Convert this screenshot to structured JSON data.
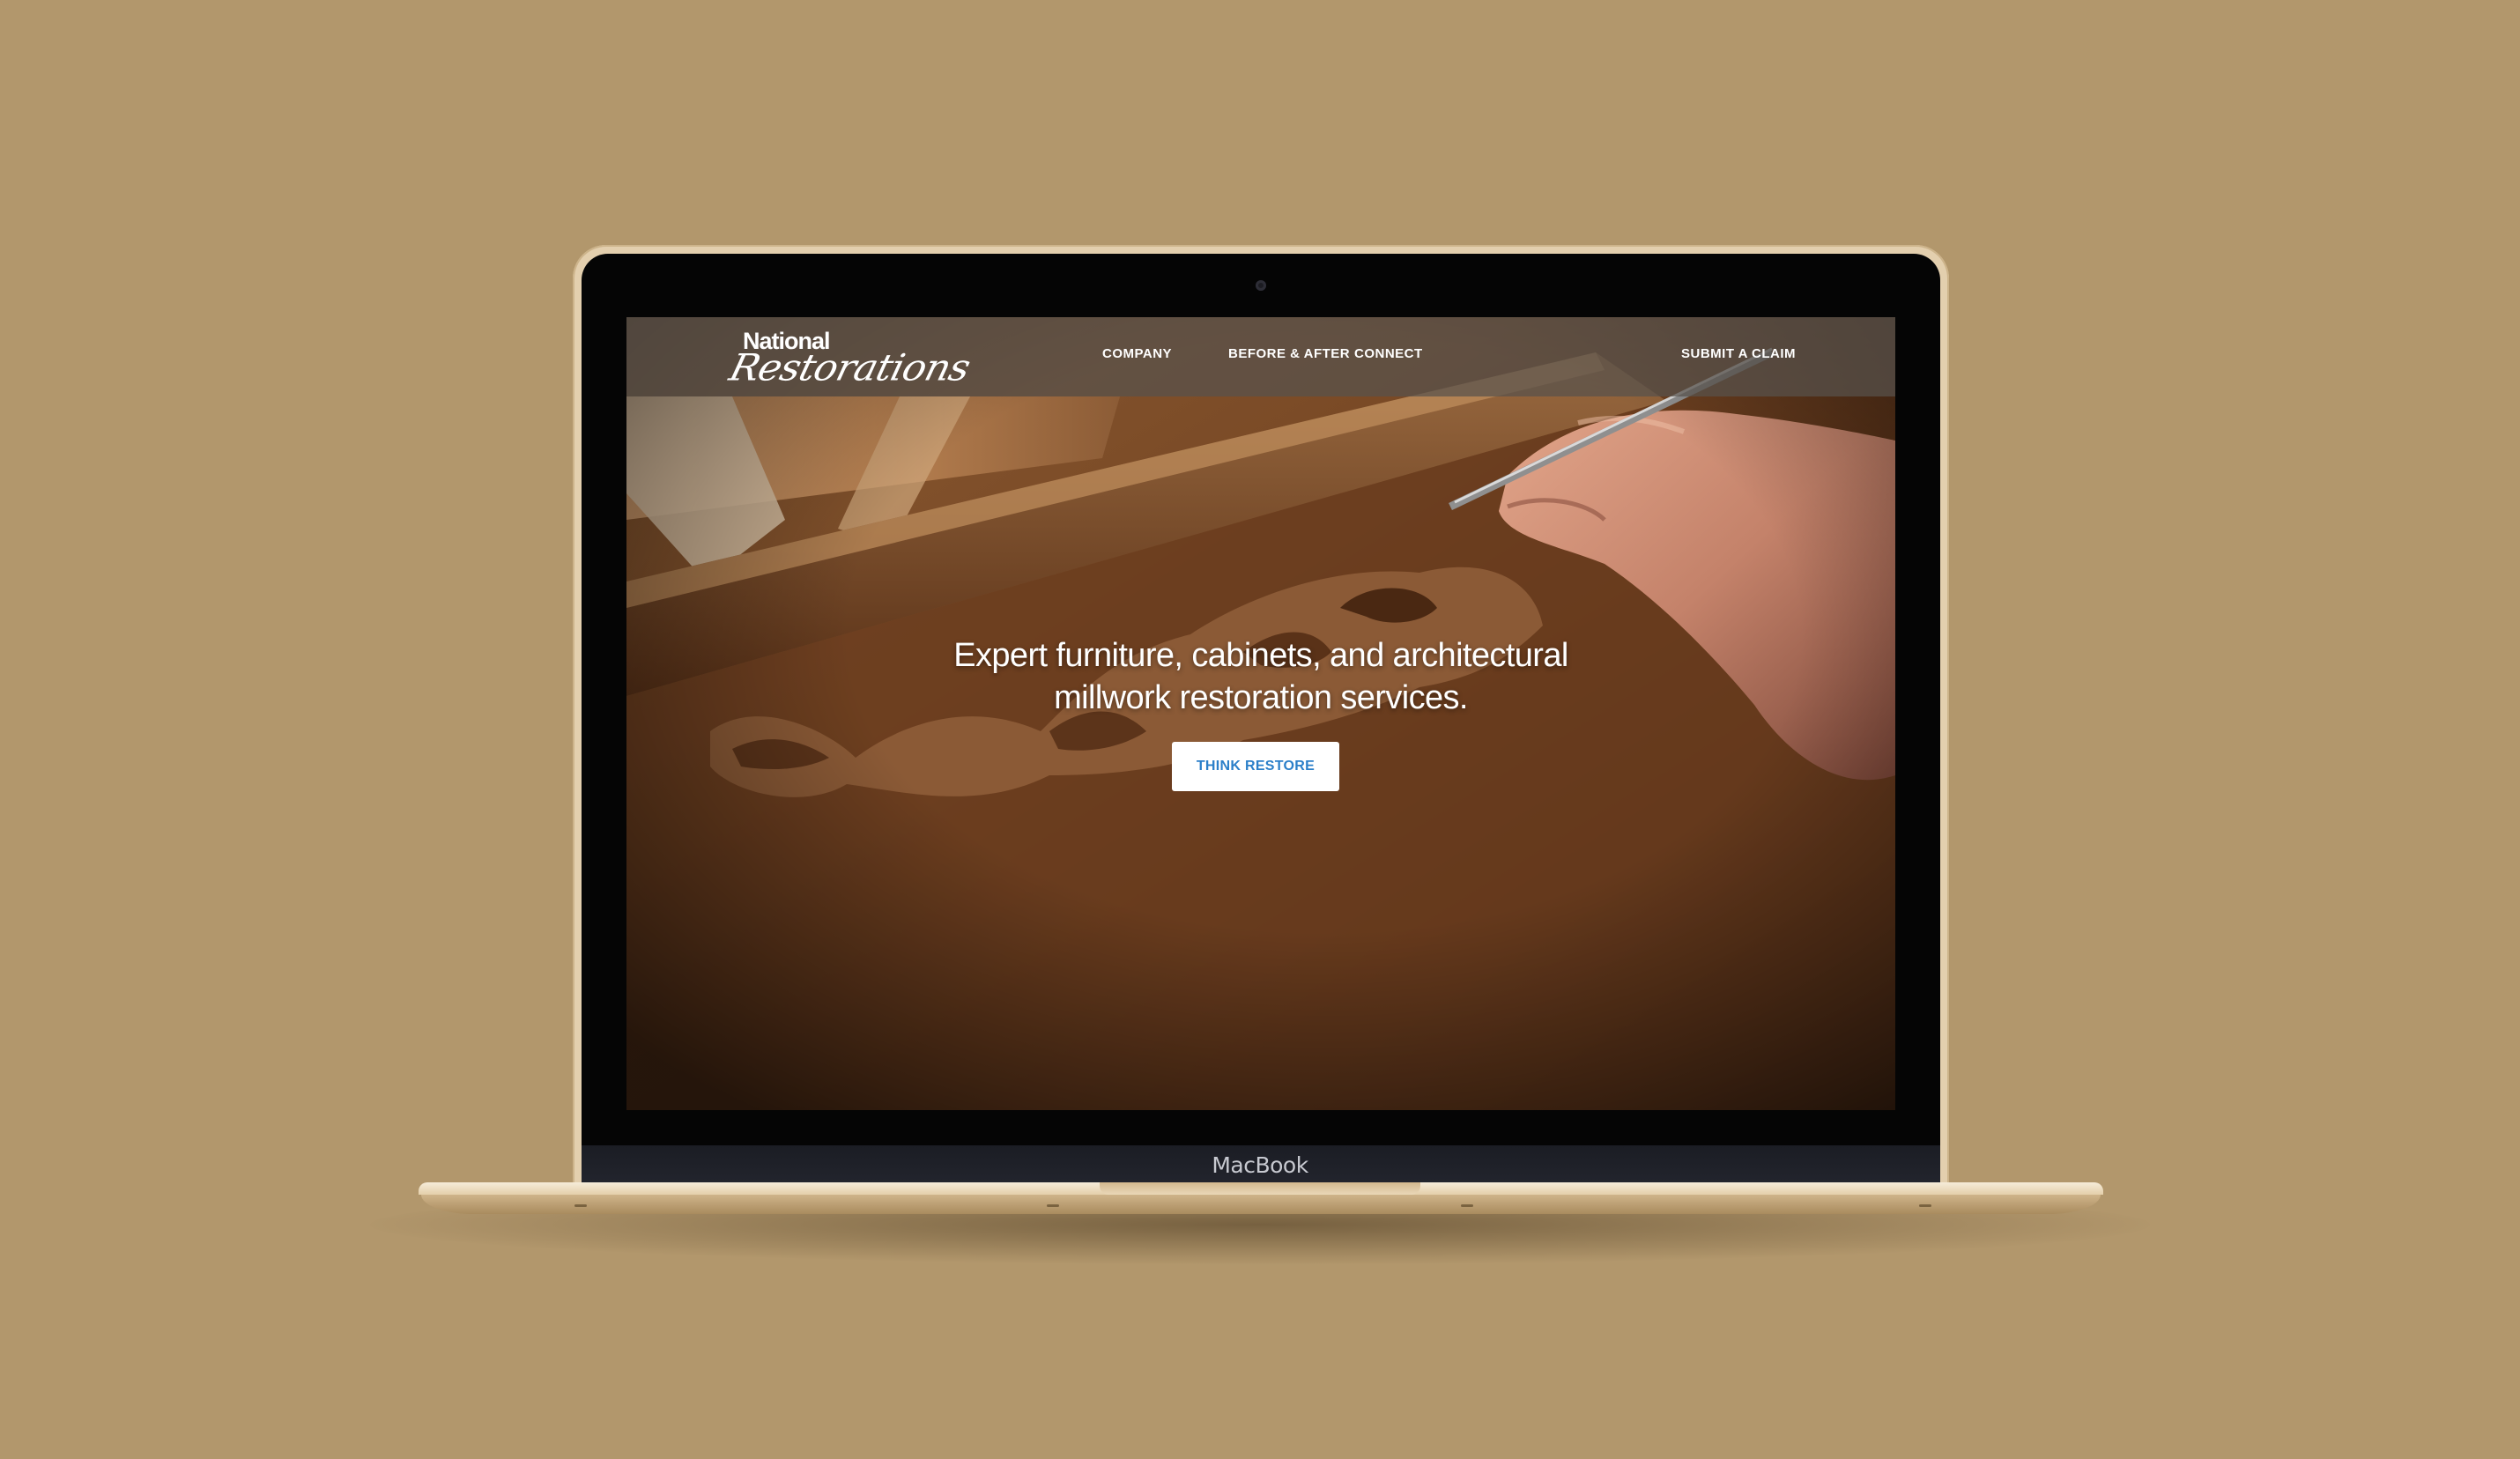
{
  "device": {
    "brand_label": "MacBook"
  },
  "site": {
    "logo": {
      "line1": "National",
      "line2": "Restorations"
    },
    "nav": {
      "company": "COMPANY",
      "before_after": "BEFORE & AFTER",
      "connect": "CONNECT",
      "submit_claim": "SUBMIT A CLAIM"
    },
    "hero": {
      "headline_line1": "Expert furniture, cabinets, and architectural",
      "headline_line2": "millwork restoration services.",
      "cta_label": "THINK RESTORE"
    }
  },
  "colors": {
    "background": "#b2976c",
    "cta_text": "#2b7fc9",
    "nav_overlay": "#58524c"
  }
}
